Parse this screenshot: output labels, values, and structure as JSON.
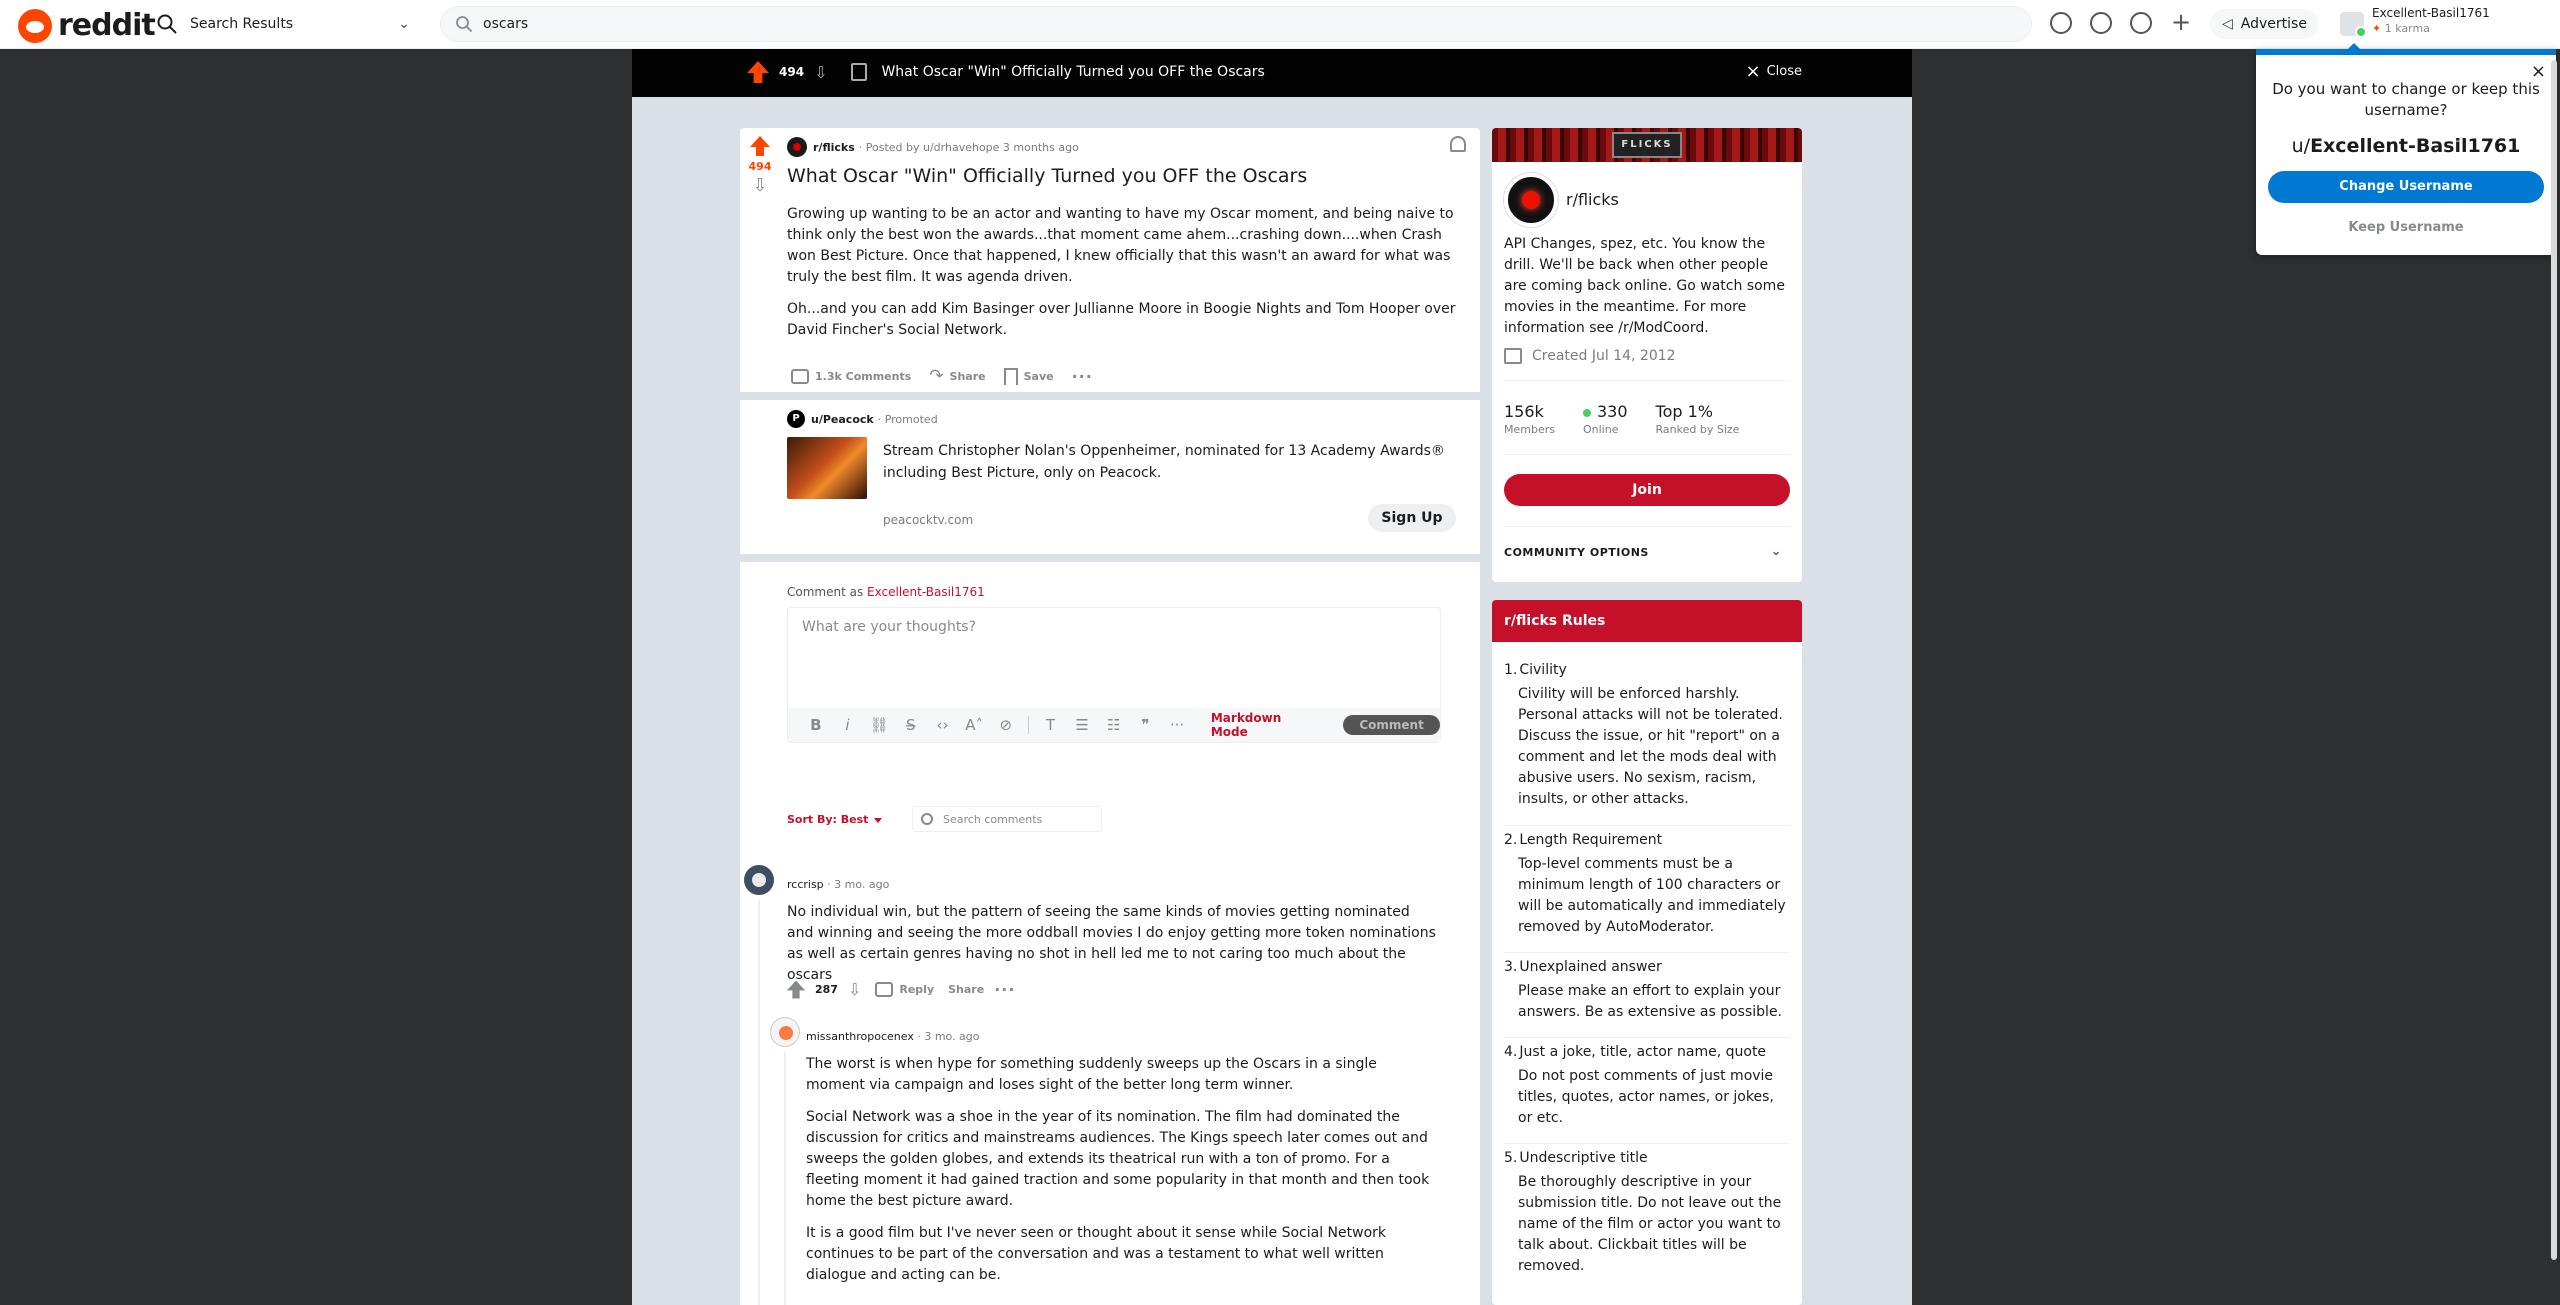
{
  "header": {
    "logo_text": "reddit",
    "home_label": "Search Results",
    "search_value": "oscars",
    "advertise_label": "Advertise",
    "user_name": "Excellent-Basil1761",
    "user_karma": "1 karma"
  },
  "post_bar": {
    "score": "494",
    "title": "What Oscar \"Win\" Officially Turned you OFF the Oscars",
    "close_label": "Close"
  },
  "post": {
    "score": "494",
    "subreddit": "r/flicks",
    "posted_by": "· Posted by u/drhavehope 3 months ago",
    "title": "What Oscar \"Win\" Officially Turned you OFF the Oscars",
    "body_1": "Growing up wanting to be an actor and wanting to have my Oscar moment, and being naive to think only the best won the awards...that moment came ahem...crashing down....when Crash won Best Picture. Once that happened, I knew officially that this wasn't an award for what was truly the best film. It was agenda driven.",
    "body_2": "Oh...and you can add Kim Basinger over Jullianne Moore in Boogie Nights and Tom Hooper over David Fincher's Social Network.",
    "comments_label": "1.3k Comments",
    "share_label": "Share",
    "save_label": "Save"
  },
  "ad": {
    "avatar_letter": "P",
    "user": "u/Peacock",
    "promoted": "· Promoted",
    "text": "Stream Christopher Nolan's Oppenheimer, nominated for 13 Academy Awards® including Best Picture, only on Peacock.",
    "url": "peacocktv.com",
    "button": "Sign Up"
  },
  "comment_form": {
    "prefix": "Comment as ",
    "user": "Excellent-Basil1761",
    "placeholder": "What are your thoughts?",
    "markdown_mode": "Markdown Mode",
    "submit": "Comment"
  },
  "sort": {
    "label": "Sort By: Best",
    "search_placeholder": "Search comments"
  },
  "comments": [
    {
      "user": "rccrisp",
      "time": " · 3 mo. ago",
      "body": [
        "No individual win, but the pattern of seeing the same kinds of movies getting nominated and winning and seeing the more oddball movies I do enjoy getting more token nominations as well as certain genres having no shot in hell led me to not caring too much about the oscars"
      ],
      "score": "287",
      "reply": "Reply",
      "share": "Share"
    },
    {
      "user": "missanthropocenex",
      "time": " · 3 mo. ago",
      "body": [
        "The worst is when hype for something suddenly sweeps up the Oscars in a single moment via campaign and loses sight of the better long term winner.",
        "Social Network was a shoe in the year of its nomination. The film had dominated the discussion for critics and mainstreams audiences. The Kings speech later comes out and sweeps the golden globes, and extends its theatrical run with a ton of promo. For a fleeting moment it had gained traction and some popularity in that month and then took home the best picture award.",
        "It is a good film but I've never seen or thought about it sense while Social Network continues to be part of the conversation and was a testament to what well written dialogue and acting can be."
      ]
    }
  ],
  "about": {
    "banner_text": "FLICKS",
    "name": "r/flicks",
    "description": "API Changes, spez, etc. You know the drill. We'll be back when other people are coming back online. Go watch some movies in the meantime. For more information see /r/ModCoord.",
    "created": "Created Jul 14, 2012",
    "members_value": "156k",
    "members_label": "Members",
    "online_value": "330",
    "online_label": "Online",
    "rank_value": "Top 1%",
    "rank_label": "Ranked by Size",
    "join": "Join",
    "community_options": "COMMUNITY OPTIONS"
  },
  "rules": {
    "title": "r/flicks Rules",
    "items": [
      {
        "n": "1.",
        "title": "Civility",
        "desc": "Civility will be enforced harshly. Personal attacks will not be tolerated. Discuss the issue, or hit \"report\" on a comment and let the mods deal with abusive users. No sexism, racism, insults, or other attacks."
      },
      {
        "n": "2.",
        "title": "Length Requirement",
        "desc": "Top-level comments must be a minimum length of 100 characters or will be automatically and immediately removed by AutoModerator."
      },
      {
        "n": "3.",
        "title": "Unexplained answer",
        "desc": "Please make an effort to explain your answers. Be as extensive as possible."
      },
      {
        "n": "4.",
        "title": "Just a joke, title, actor name, quote",
        "desc": "Do not post comments of just movie titles, quotes, actor names, or jokes, or etc."
      },
      {
        "n": "5.",
        "title": "Undescriptive title",
        "desc": "Be thoroughly descriptive in your submission title. Do not leave out the name of the film or actor you want to talk about. Clickbait titles will be removed."
      }
    ]
  },
  "username_popup": {
    "question": "Do you want to change or keep this username?",
    "prefix": "u/",
    "username": "Excellent-Basil1761",
    "change": "Change Username",
    "keep": "Keep Username"
  }
}
